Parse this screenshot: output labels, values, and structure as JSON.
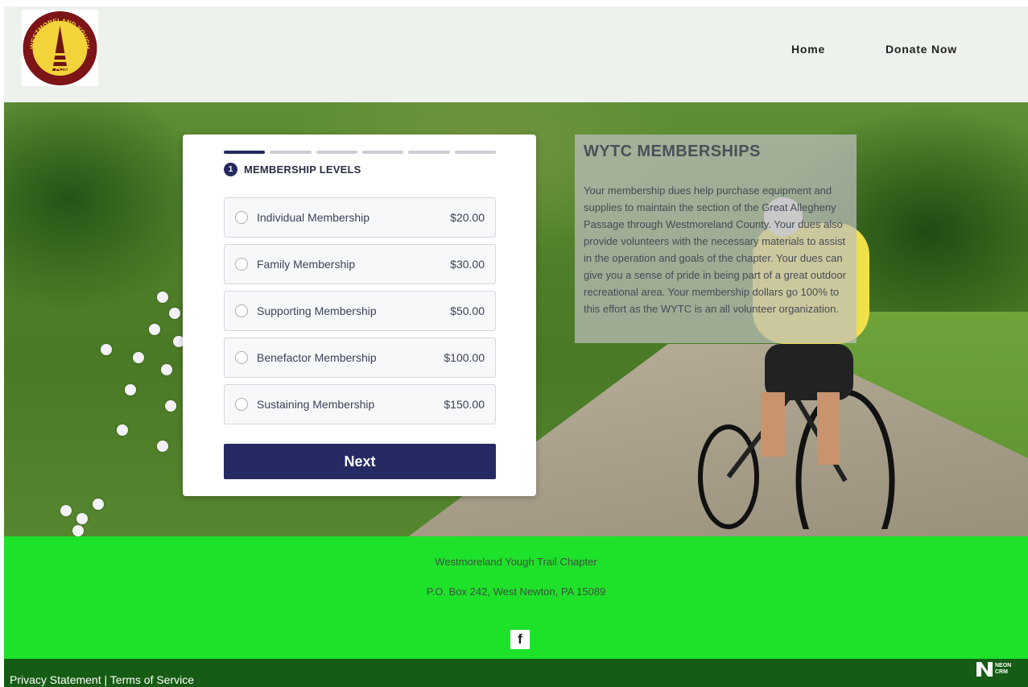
{
  "header": {
    "logo": {
      "name": "Westmoreland Yough Trail Chapter logo",
      "text_top": "WESTMORELAND YOUGH",
      "text_bottom": "TRAIL CHAPTER"
    },
    "nav": [
      {
        "label": "Home"
      },
      {
        "label": "Donate Now"
      }
    ]
  },
  "form": {
    "step_count": 6,
    "current_step": 1,
    "step_number": "1",
    "step_title": "MEMBERSHIP LEVELS",
    "levels": [
      {
        "name": "Individual Membership",
        "price": "$20.00"
      },
      {
        "name": "Family Membership",
        "price": "$30.00"
      },
      {
        "name": "Supporting Membership",
        "price": "$50.00"
      },
      {
        "name": "Benefactor Membership",
        "price": "$100.00"
      },
      {
        "name": "Sustaining Membership",
        "price": "$150.00"
      }
    ],
    "next_label": "Next"
  },
  "info": {
    "title": "WYTC MEMBERSHIPS",
    "body": "Your membership dues help purchase equipment and supplies to maintain the section of the Great Allegheny Passage through Westmoreland County.  Your dues also provide volunteers with the necessary materials to assist in the operation and goals of the chapter.  Your dues can give you a sense of pride in being part of a great outdoor recreational area.  Your membership dollars go 100% to this effort as the WYTC is an all volunteer organization."
  },
  "footer": {
    "org_name": "Westmoreland Yough Trail Chapter",
    "address": "P.O. Box 242, West Newton, PA   15089",
    "social_icon": "facebook-icon",
    "privacy_label": "Privacy Statement",
    "separator": " | ",
    "terms_label": "Terms of Service",
    "neon_brand_line1": "NEON",
    "neon_brand_line2": "CRM"
  },
  "colors": {
    "header_bg": "#edf2ed",
    "primary": "#252a63",
    "footer_bg": "#1ee22a",
    "bottom_bar_bg": "#165c14"
  }
}
